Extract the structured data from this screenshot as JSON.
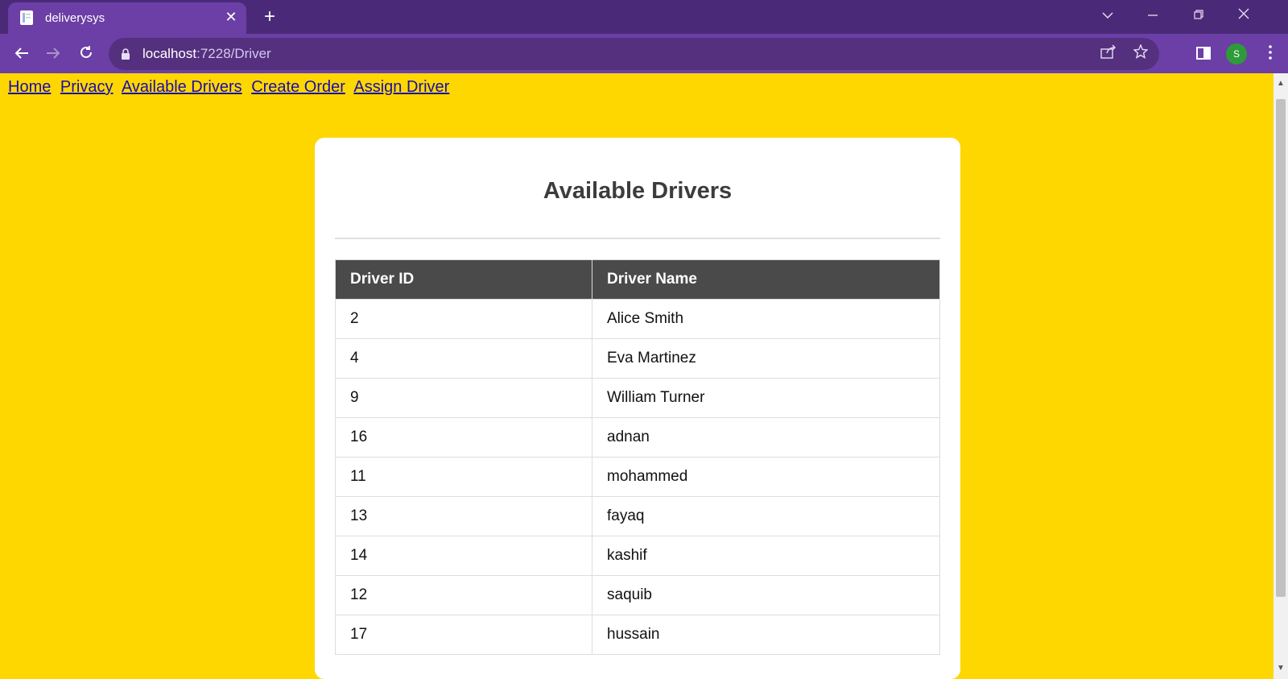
{
  "browser": {
    "tab_title": "deliverysys",
    "tab_close": "✕",
    "new_tab": "+",
    "url_host": "localhost",
    "url_path": ":7228/Driver",
    "avatar_letter": "S",
    "icons": [
      "back-arrow-icon",
      "forward-arrow-icon",
      "reload-icon",
      "lock-icon",
      "share-icon",
      "star-icon",
      "side-panel-icon",
      "kebab-menu-icon",
      "tab-search-icon",
      "minimize-icon",
      "restore-icon",
      "close-window-icon"
    ],
    "colors": {
      "tabbar": "#4a2a78",
      "toolbar": "#6b3fa5",
      "omnibox": "#54307f"
    }
  },
  "nav": {
    "home": "Home",
    "privacy": "Privacy",
    "available_drivers": "Available Drivers",
    "create_order": "Create Order",
    "assign_driver": "Assign Driver"
  },
  "card": {
    "title": "Available Drivers"
  },
  "table": {
    "headers": [
      "Driver ID",
      "Driver Name"
    ],
    "rows": [
      [
        "2",
        "Alice Smith"
      ],
      [
        "4",
        "Eva Martinez"
      ],
      [
        "9",
        "William Turner"
      ],
      [
        "16",
        "adnan"
      ],
      [
        "11",
        "mohammed"
      ],
      [
        "13",
        "fayaq"
      ],
      [
        "14",
        "kashif"
      ],
      [
        "12",
        "saquib"
      ],
      [
        "17",
        "hussain"
      ]
    ]
  },
  "colors": {
    "page_bg": "#ffd700",
    "link": "#1a0dab",
    "table_header_bg": "#4a4a4a"
  }
}
